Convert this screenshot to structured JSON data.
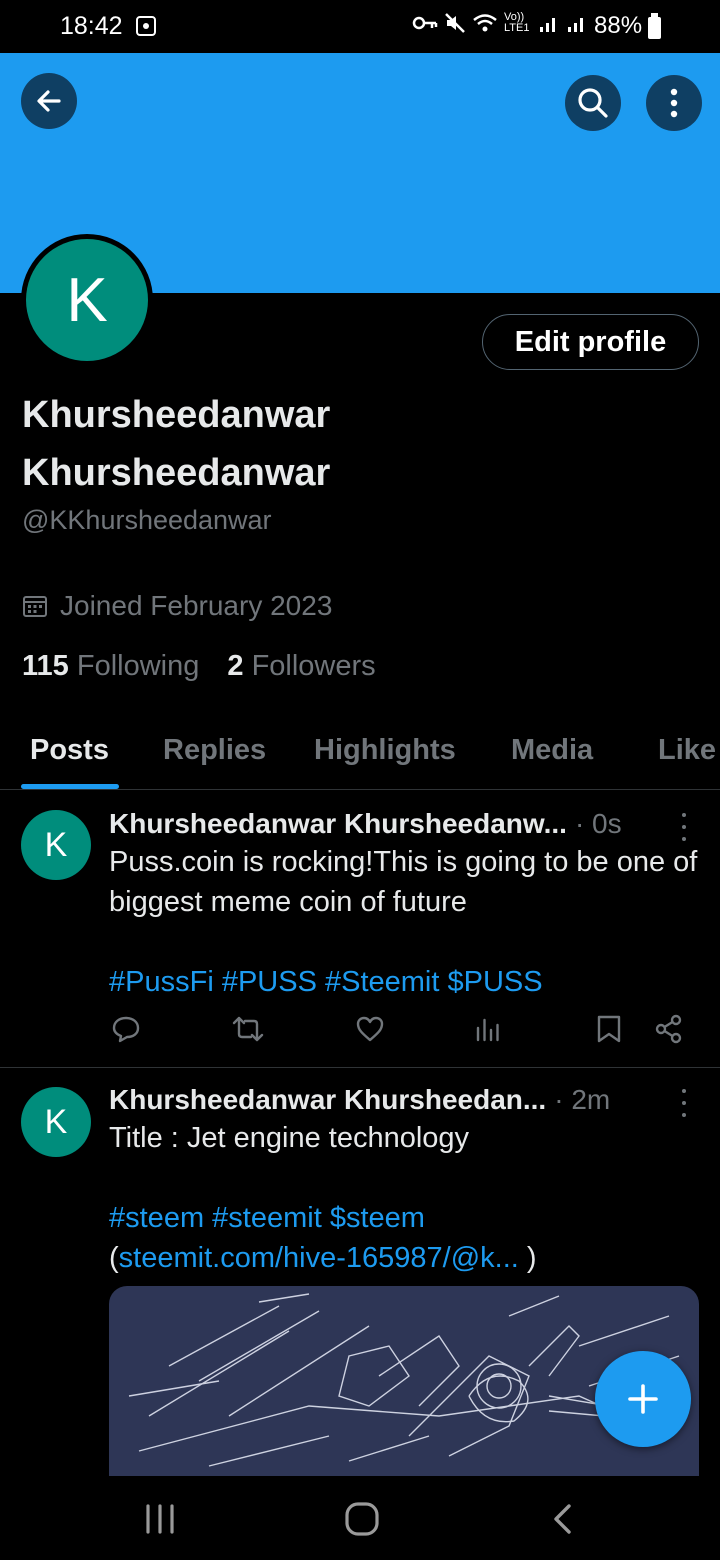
{
  "status_bar": {
    "time": "18:42",
    "battery": "88%",
    "network_label": "Vo)) LTE1"
  },
  "profile": {
    "avatar_letter": "K",
    "edit_button": "Edit profile",
    "display_name": "Khursheedanwar Khursheedanwar",
    "handle": "@KKhursheedanwar",
    "joined": "Joined February 2023",
    "following_count": "115",
    "following_label": "Following",
    "followers_count": "2",
    "followers_label": "Followers"
  },
  "tabs": [
    {
      "label": "Posts",
      "active": true
    },
    {
      "label": "Replies"
    },
    {
      "label": "Highlights"
    },
    {
      "label": "Media"
    },
    {
      "label": "Like"
    }
  ],
  "posts": [
    {
      "avatar_letter": "K",
      "name": "Khursheedanwar Khursheedanw...",
      "time": "· 0s",
      "text": "Puss.coin is rocking!This is going to be one of biggest meme coin of future",
      "hashtags": "#PussFi #PUSS #Steemit $PUSS"
    },
    {
      "avatar_letter": "K",
      "name": "Khursheedanwar Khursheedan...",
      "time": "· 2m",
      "text": "Title : Jet engine technology",
      "hashtags": "#steem #steemit $steem",
      "link_open": "(",
      "link": "steemit.com/hive-165987/@k...",
      "link_close": " )"
    }
  ],
  "colors": {
    "accent": "#1d9bf0",
    "avatar_bg": "#008d7c",
    "muted_text": "#71767b"
  }
}
